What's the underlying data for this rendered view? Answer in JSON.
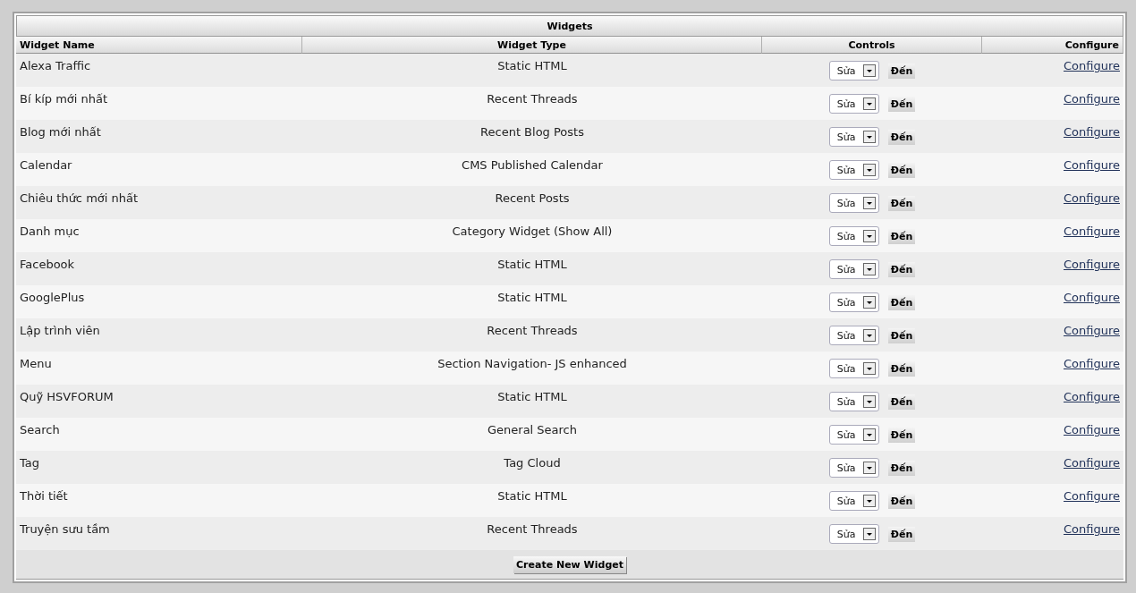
{
  "title": "Widgets",
  "columns": [
    "Widget Name",
    "Widget Type",
    "Controls",
    "Configure"
  ],
  "rows": [
    {
      "name": "Alexa Traffic",
      "type": "Static HTML",
      "select": "Sửa",
      "go": "Đến",
      "link": "Configure"
    },
    {
      "name": "Bí kíp mới nhất",
      "type": "Recent Threads",
      "select": "Sửa",
      "go": "Đến",
      "link": "Configure"
    },
    {
      "name": "Blog mới nhất",
      "type": "Recent Blog Posts",
      "select": "Sửa",
      "go": "Đến",
      "link": "Configure"
    },
    {
      "name": "Calendar",
      "type": "CMS Published Calendar",
      "select": "Sửa",
      "go": "Đến",
      "link": "Configure"
    },
    {
      "name": "Chiêu thức mới nhất",
      "type": "Recent Posts",
      "select": "Sửa",
      "go": "Đến",
      "link": "Configure"
    },
    {
      "name": "Danh mục",
      "type": "Category Widget (Show All)",
      "select": "Sửa",
      "go": "Đến",
      "link": "Configure"
    },
    {
      "name": "Facebook",
      "type": "Static HTML",
      "select": "Sửa",
      "go": "Đến",
      "link": "Configure"
    },
    {
      "name": "GooglePlus",
      "type": "Static HTML",
      "select": "Sửa",
      "go": "Đến",
      "link": "Configure"
    },
    {
      "name": "Lập trình viên",
      "type": "Recent Threads",
      "select": "Sửa",
      "go": "Đến",
      "link": "Configure"
    },
    {
      "name": "Menu",
      "type": "Section Navigation- JS enhanced",
      "select": "Sửa",
      "go": "Đến",
      "link": "Configure"
    },
    {
      "name": "Quỹ HSVFORUM",
      "type": "Static HTML",
      "select": "Sửa",
      "go": "Đến",
      "link": "Configure"
    },
    {
      "name": "Search",
      "type": "General Search",
      "select": "Sửa",
      "go": "Đến",
      "link": "Configure"
    },
    {
      "name": "Tag",
      "type": "Tag Cloud",
      "select": "Sửa",
      "go": "Đến",
      "link": "Configure"
    },
    {
      "name": "Thời tiết",
      "type": "Static HTML",
      "select": "Sửa",
      "go": "Đến",
      "link": "Configure"
    },
    {
      "name": "Truyện sưu tầm",
      "type": "Recent Threads",
      "select": "Sửa",
      "go": "Đến",
      "link": "Configure"
    }
  ],
  "create_button": "Create New Widget"
}
